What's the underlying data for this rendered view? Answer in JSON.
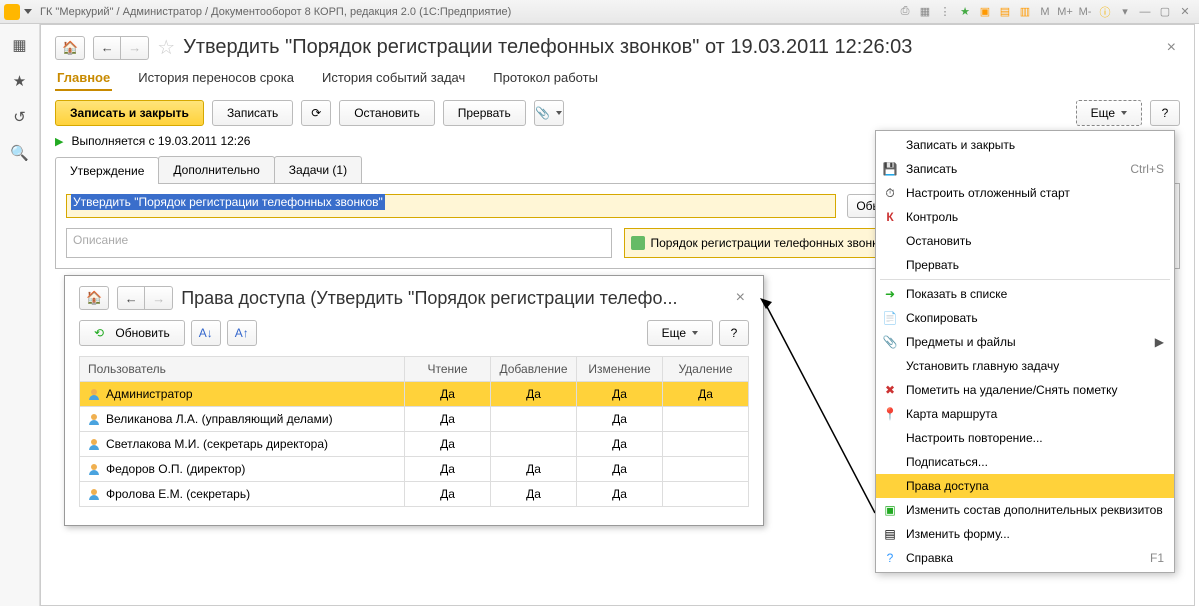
{
  "titlebar": {
    "text": "ГК \"Меркурий\" / Администратор / Документооборот 8 КОРП, редакция 2.0  (1С:Предприятие)"
  },
  "page": {
    "title": "Утвердить \"Порядок регистрации телефонных звонков\" от 19.03.2011 12:26:03"
  },
  "navtabs": {
    "main": "Главное",
    "history": "История переносов срока",
    "events": "История событий задач",
    "protocol": "Протокол работы"
  },
  "toolbar": {
    "save_close": "Записать и закрыть",
    "save": "Записать",
    "stop": "Остановить",
    "abort": "Прервать",
    "more": "Еще"
  },
  "status": {
    "text": "Выполняется с 19.03.2011 12:26"
  },
  "subtabs": {
    "approve": "Утверждение",
    "extra": "Дополнительно",
    "tasks": "Задачи (1)"
  },
  "form": {
    "title_value": "Утвердить \"Порядок регистрации телефонных звонков\"",
    "usual": "Обычна",
    "desc_placeholder": "Описание",
    "doc_title": "Порядок регистрации телефонных звонков (Информационно"
  },
  "modal": {
    "title": "Права доступа (Утвердить \"Порядок регистрации телефо...",
    "refresh": "Обновить",
    "more": "Еще",
    "cols": {
      "user": "Пользователь",
      "read": "Чтение",
      "add": "Добавление",
      "edit": "Изменение",
      "del": "Удаление"
    },
    "yes": "Да",
    "rows": [
      {
        "name": "Администратор",
        "r": "Да",
        "a": "Да",
        "e": "Да",
        "d": "Да",
        "sel": true
      },
      {
        "name": "Великанова Л.А. (управляющий делами)",
        "r": "Да",
        "a": "",
        "e": "Да",
        "d": ""
      },
      {
        "name": "Светлакова М.И. (секретарь директора)",
        "r": "Да",
        "a": "",
        "e": "Да",
        "d": ""
      },
      {
        "name": "Федоров О.П. (директор)",
        "r": "Да",
        "a": "Да",
        "e": "Да",
        "d": ""
      },
      {
        "name": "Фролова Е.М. (секретарь)",
        "r": "Да",
        "a": "Да",
        "e": "Да",
        "d": ""
      }
    ]
  },
  "menu": {
    "save_close": "Записать и закрыть",
    "save": "Записать",
    "save_shortcut": "Ctrl+S",
    "deferred": "Настроить отложенный старт",
    "control": "Контроль",
    "stop": "Остановить",
    "abort": "Прервать",
    "show_list": "Показать в списке",
    "copy": "Скопировать",
    "items_files": "Предметы и файлы",
    "set_main": "Установить главную задачу",
    "mark_delete": "Пометить на удаление/Снять пометку",
    "route_map": "Карта маршрута",
    "repeat": "Настроить повторение...",
    "subscribe": "Подписаться...",
    "access": "Права доступа",
    "extra_fields": "Изменить состав дополнительных реквизитов",
    "edit_form": "Изменить форму...",
    "help": "Справка",
    "help_shortcut": "F1"
  }
}
